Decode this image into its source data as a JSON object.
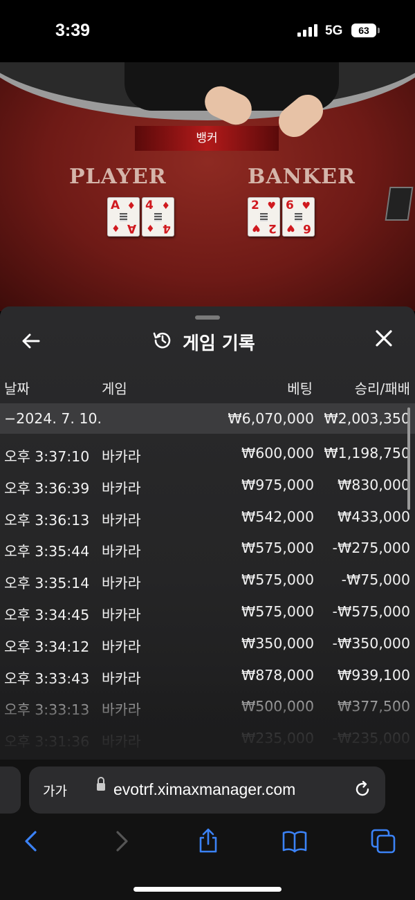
{
  "status_bar": {
    "time": "3:39",
    "network": "5G",
    "battery": "63"
  },
  "game": {
    "banner": "뱅커",
    "player_label": "PLAYER",
    "banker_label": "BANKER",
    "player_cards": [
      {
        "rank": "A",
        "suit": "♦"
      },
      {
        "rank": "4",
        "suit": "♦"
      }
    ],
    "banker_cards": [
      {
        "rank": "2",
        "suit": "♥"
      },
      {
        "rank": "6",
        "suit": "♥"
      }
    ]
  },
  "history": {
    "title": "게임 기록",
    "columns": {
      "date": "날짜",
      "game": "게임",
      "bet": "베팅",
      "result": "승리/패배"
    },
    "summary": {
      "date": "−2024. 7. 10.",
      "bet": "₩6,070,000",
      "result": "₩2,003,350"
    },
    "rows": [
      {
        "time": "오후 3:37:10",
        "game": "바카라",
        "bet": "₩600,000",
        "result": "₩1,198,750"
      },
      {
        "time": "오후 3:36:39",
        "game": "바카라",
        "bet": "₩975,000",
        "result": "₩830,000"
      },
      {
        "time": "오후 3:36:13",
        "game": "바카라",
        "bet": "₩542,000",
        "result": "₩433,000"
      },
      {
        "time": "오후 3:35:44",
        "game": "바카라",
        "bet": "₩575,000",
        "result": "-₩275,000"
      },
      {
        "time": "오후 3:35:14",
        "game": "바카라",
        "bet": "₩575,000",
        "result": "-₩75,000"
      },
      {
        "time": "오후 3:34:45",
        "game": "바카라",
        "bet": "₩575,000",
        "result": "-₩575,000"
      },
      {
        "time": "오후 3:34:12",
        "game": "바카라",
        "bet": "₩350,000",
        "result": "-₩350,000"
      },
      {
        "time": "오후 3:33:43",
        "game": "바카라",
        "bet": "₩878,000",
        "result": "₩939,100"
      },
      {
        "time": "오후 3:33:13",
        "game": "바카라",
        "bet": "₩500,000",
        "result": "₩377,500"
      },
      {
        "time": "오후 3:31:36",
        "game": "바카라",
        "bet": "₩235,000",
        "result": "-₩235,000"
      }
    ]
  },
  "browser": {
    "text_size_label": "가가",
    "domain": "evotrf.ximaxmanager.com"
  },
  "icons": [
    "back-arrow-icon",
    "history-icon",
    "close-icon",
    "lock-icon",
    "reload-icon",
    "nav-back-icon",
    "nav-forward-icon",
    "share-icon",
    "bookmarks-icon",
    "tabs-icon"
  ],
  "colors": {
    "felt": "#7a1d17",
    "panel": "#262627",
    "accent_blue": "#3b82f6"
  }
}
